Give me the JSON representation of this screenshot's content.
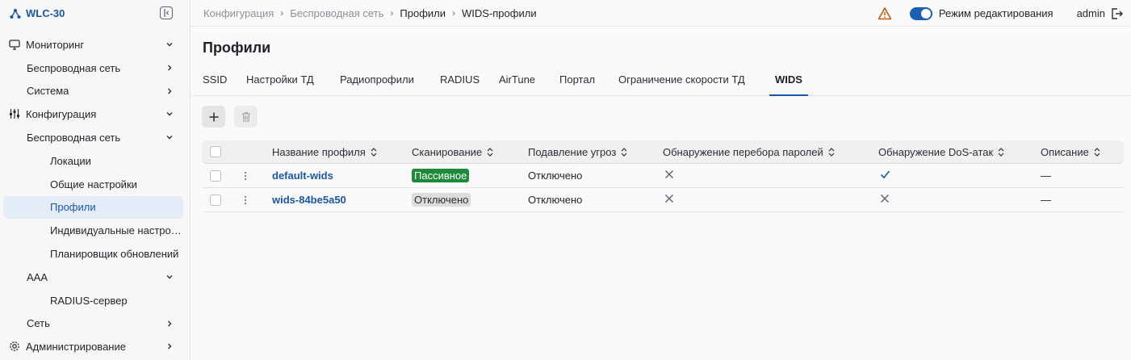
{
  "app": {
    "name": "WLC-30"
  },
  "sidebar": {
    "items": [
      {
        "label": "Мониторинг",
        "icon": "monitor-icon"
      },
      {
        "label": "Беспроводная сеть"
      },
      {
        "label": "Система"
      },
      {
        "label": "Конфигурация",
        "icon": "sliders-icon"
      },
      {
        "label": "Беспроводная сеть"
      },
      {
        "label": "Локации"
      },
      {
        "label": "Общие настройки"
      },
      {
        "label": "Профили"
      },
      {
        "label": "Индивидуальные настройки"
      },
      {
        "label": "Планировщик обновлений"
      },
      {
        "label": "AAA"
      },
      {
        "label": "RADIUS-сервер"
      },
      {
        "label": "Сеть"
      },
      {
        "label": "Администрирование",
        "icon": "gear-icon"
      }
    ]
  },
  "breadcrumb": [
    "Конфигурация",
    "Беспроводная сеть",
    "Профили",
    "WIDS-профили"
  ],
  "header": {
    "edit_mode_label": "Режим редактирования",
    "edit_mode_on": true,
    "user": "admin"
  },
  "page": {
    "title": "Профили"
  },
  "tabs": [
    "SSID",
    "Настройки ТД",
    "Радиопрофили",
    "RADIUS",
    "AirTune",
    "Портал",
    "Ограничение скорости ТД",
    "WIDS"
  ],
  "active_tab": "WIDS",
  "table": {
    "columns": [
      "Название профиля",
      "Сканирование",
      "Подавление угроз",
      "Обнаружение перебора паролей",
      "Обнаружение DoS-атак",
      "Описание"
    ],
    "rows": [
      {
        "name": "default-wids",
        "scan": "Пассивное",
        "scan_style": "green",
        "suppress": "Отключено",
        "brute": "cross",
        "dos": "check",
        "desc": "—"
      },
      {
        "name": "wids-84be5a50",
        "scan": "Отключено",
        "scan_style": "gray",
        "suppress": "Отключено",
        "brute": "cross",
        "dos": "cross",
        "desc": "—"
      }
    ]
  },
  "colors": {
    "accent": "#1a56a8",
    "toggle": "#1a5fb4",
    "badge_green": "#1e8b3a",
    "warning": "#c75a12"
  }
}
